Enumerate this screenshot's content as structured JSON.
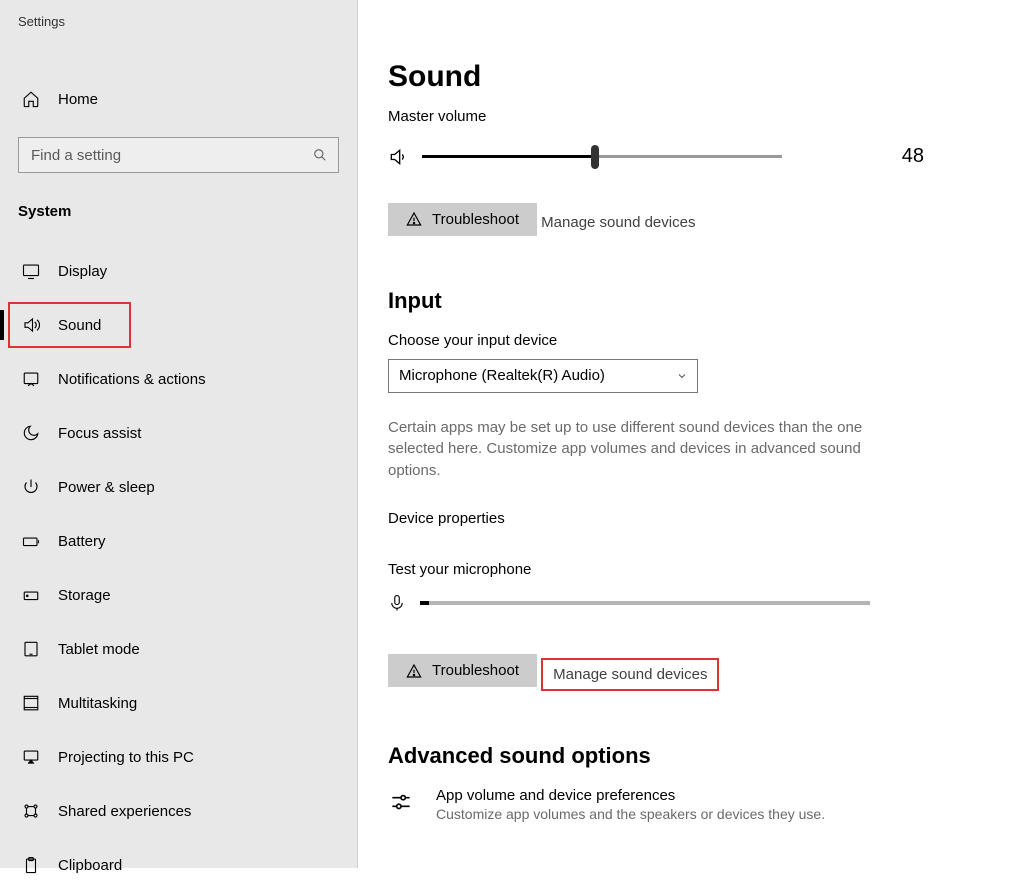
{
  "window": {
    "title": "Settings"
  },
  "sidebar": {
    "home": "Home",
    "searchPlaceholder": "Find a setting",
    "section": "System",
    "items": [
      {
        "label": "Display"
      },
      {
        "label": "Sound",
        "active": true
      },
      {
        "label": "Notifications & actions"
      },
      {
        "label": "Focus assist"
      },
      {
        "label": "Power & sleep"
      },
      {
        "label": "Battery"
      },
      {
        "label": "Storage"
      },
      {
        "label": "Tablet mode"
      },
      {
        "label": "Multitasking"
      },
      {
        "label": "Projecting to this PC"
      },
      {
        "label": "Shared experiences"
      },
      {
        "label": "Clipboard"
      }
    ]
  },
  "main": {
    "title": "Sound",
    "masterVolume": {
      "label": "Master volume",
      "value": 48
    },
    "troubleshoot": "Troubleshoot",
    "manageDevices": "Manage sound devices",
    "input": {
      "heading": "Input",
      "chooseLabel": "Choose your input device",
      "selected": "Microphone (Realtek(R) Audio)",
      "description": "Certain apps may be set up to use different sound devices than the one selected here. Customize app volumes and devices in advanced sound options.",
      "deviceProps": "Device properties",
      "testLabel": "Test your microphone",
      "troubleshoot": "Troubleshoot",
      "manageDevices": "Manage sound devices"
    },
    "advanced": {
      "heading": "Advanced sound options",
      "item": {
        "title": "App volume and device preferences",
        "sub": "Customize app volumes and the speakers or devices they use."
      }
    }
  }
}
